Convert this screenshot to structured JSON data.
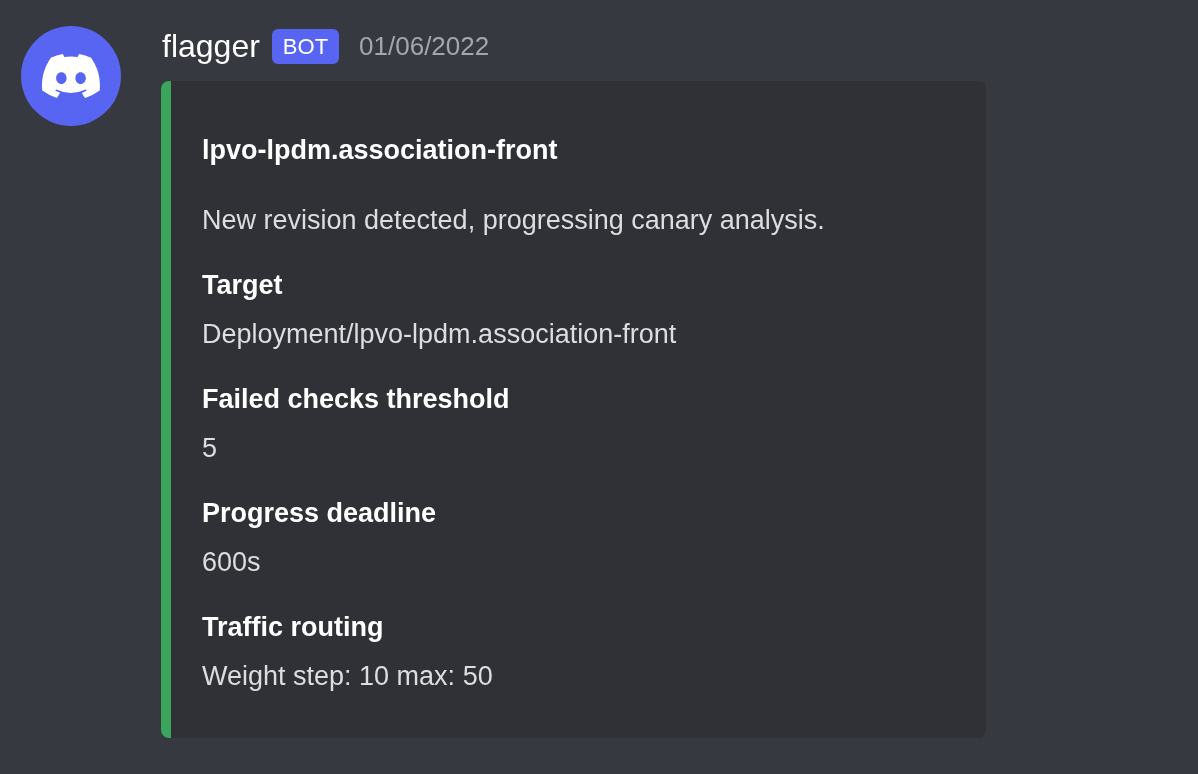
{
  "message": {
    "author": "flagger",
    "badge": "BOT",
    "timestamp": "01/06/2022"
  },
  "embed": {
    "title": "lpvo-lpdm.association-front",
    "description": "New revision detected, progressing canary analysis.",
    "fields": [
      {
        "name": "Target",
        "value": "Deployment/lpvo-lpdm.association-front"
      },
      {
        "name": "Failed checks threshold",
        "value": "5"
      },
      {
        "name": "Progress deadline",
        "value": "600s"
      },
      {
        "name": "Traffic routing",
        "value": "Weight step: 10 max: 50"
      }
    ]
  }
}
